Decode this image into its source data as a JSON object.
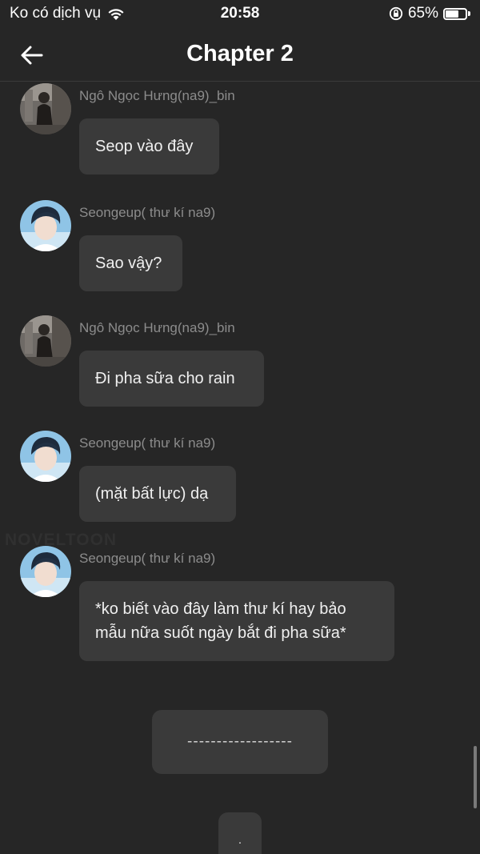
{
  "status_bar": {
    "carrier": "Ko có dịch vụ",
    "time": "20:58",
    "battery_percent": "65%",
    "battery_level": 0.65,
    "icons": [
      "wifi-icon",
      "orientation-lock-icon",
      "battery-icon"
    ]
  },
  "header": {
    "title": "Chapter 2",
    "back_icon": "arrow-left-icon"
  },
  "watermark": "NOVELTOON",
  "messages": [
    {
      "sender": "Ngô Ngọc Hưng(na9)_bin",
      "text": "Seop vào đây",
      "avatar": "avatar-bin"
    },
    {
      "sender": "Seongeup( thư kí na9)",
      "text": "Sao vậy?",
      "avatar": "avatar-seongeup"
    },
    {
      "sender": "Ngô Ngọc Hưng(na9)_bin",
      "text": "Đi pha sữa cho rain",
      "avatar": "avatar-bin"
    },
    {
      "sender": "Seongeup( thư kí na9)",
      "text": "(mặt bất lực) dạ",
      "avatar": "avatar-seongeup"
    },
    {
      "sender": "Seongeup( thư kí na9)",
      "text_line1": "*ko biết vào đây làm thư kí hay bảo",
      "text_line2": "mẫu nữa suốt ngày bắt đi pha sữa*",
      "avatar": "avatar-seongeup"
    }
  ],
  "narration": [
    {
      "text": "------------------"
    },
    {
      "text": "."
    }
  ],
  "colors": {
    "background": "#262626",
    "bubble": "#3a3a3a",
    "sender_name": "#8c8c8c",
    "text": "#f0f0f0"
  }
}
